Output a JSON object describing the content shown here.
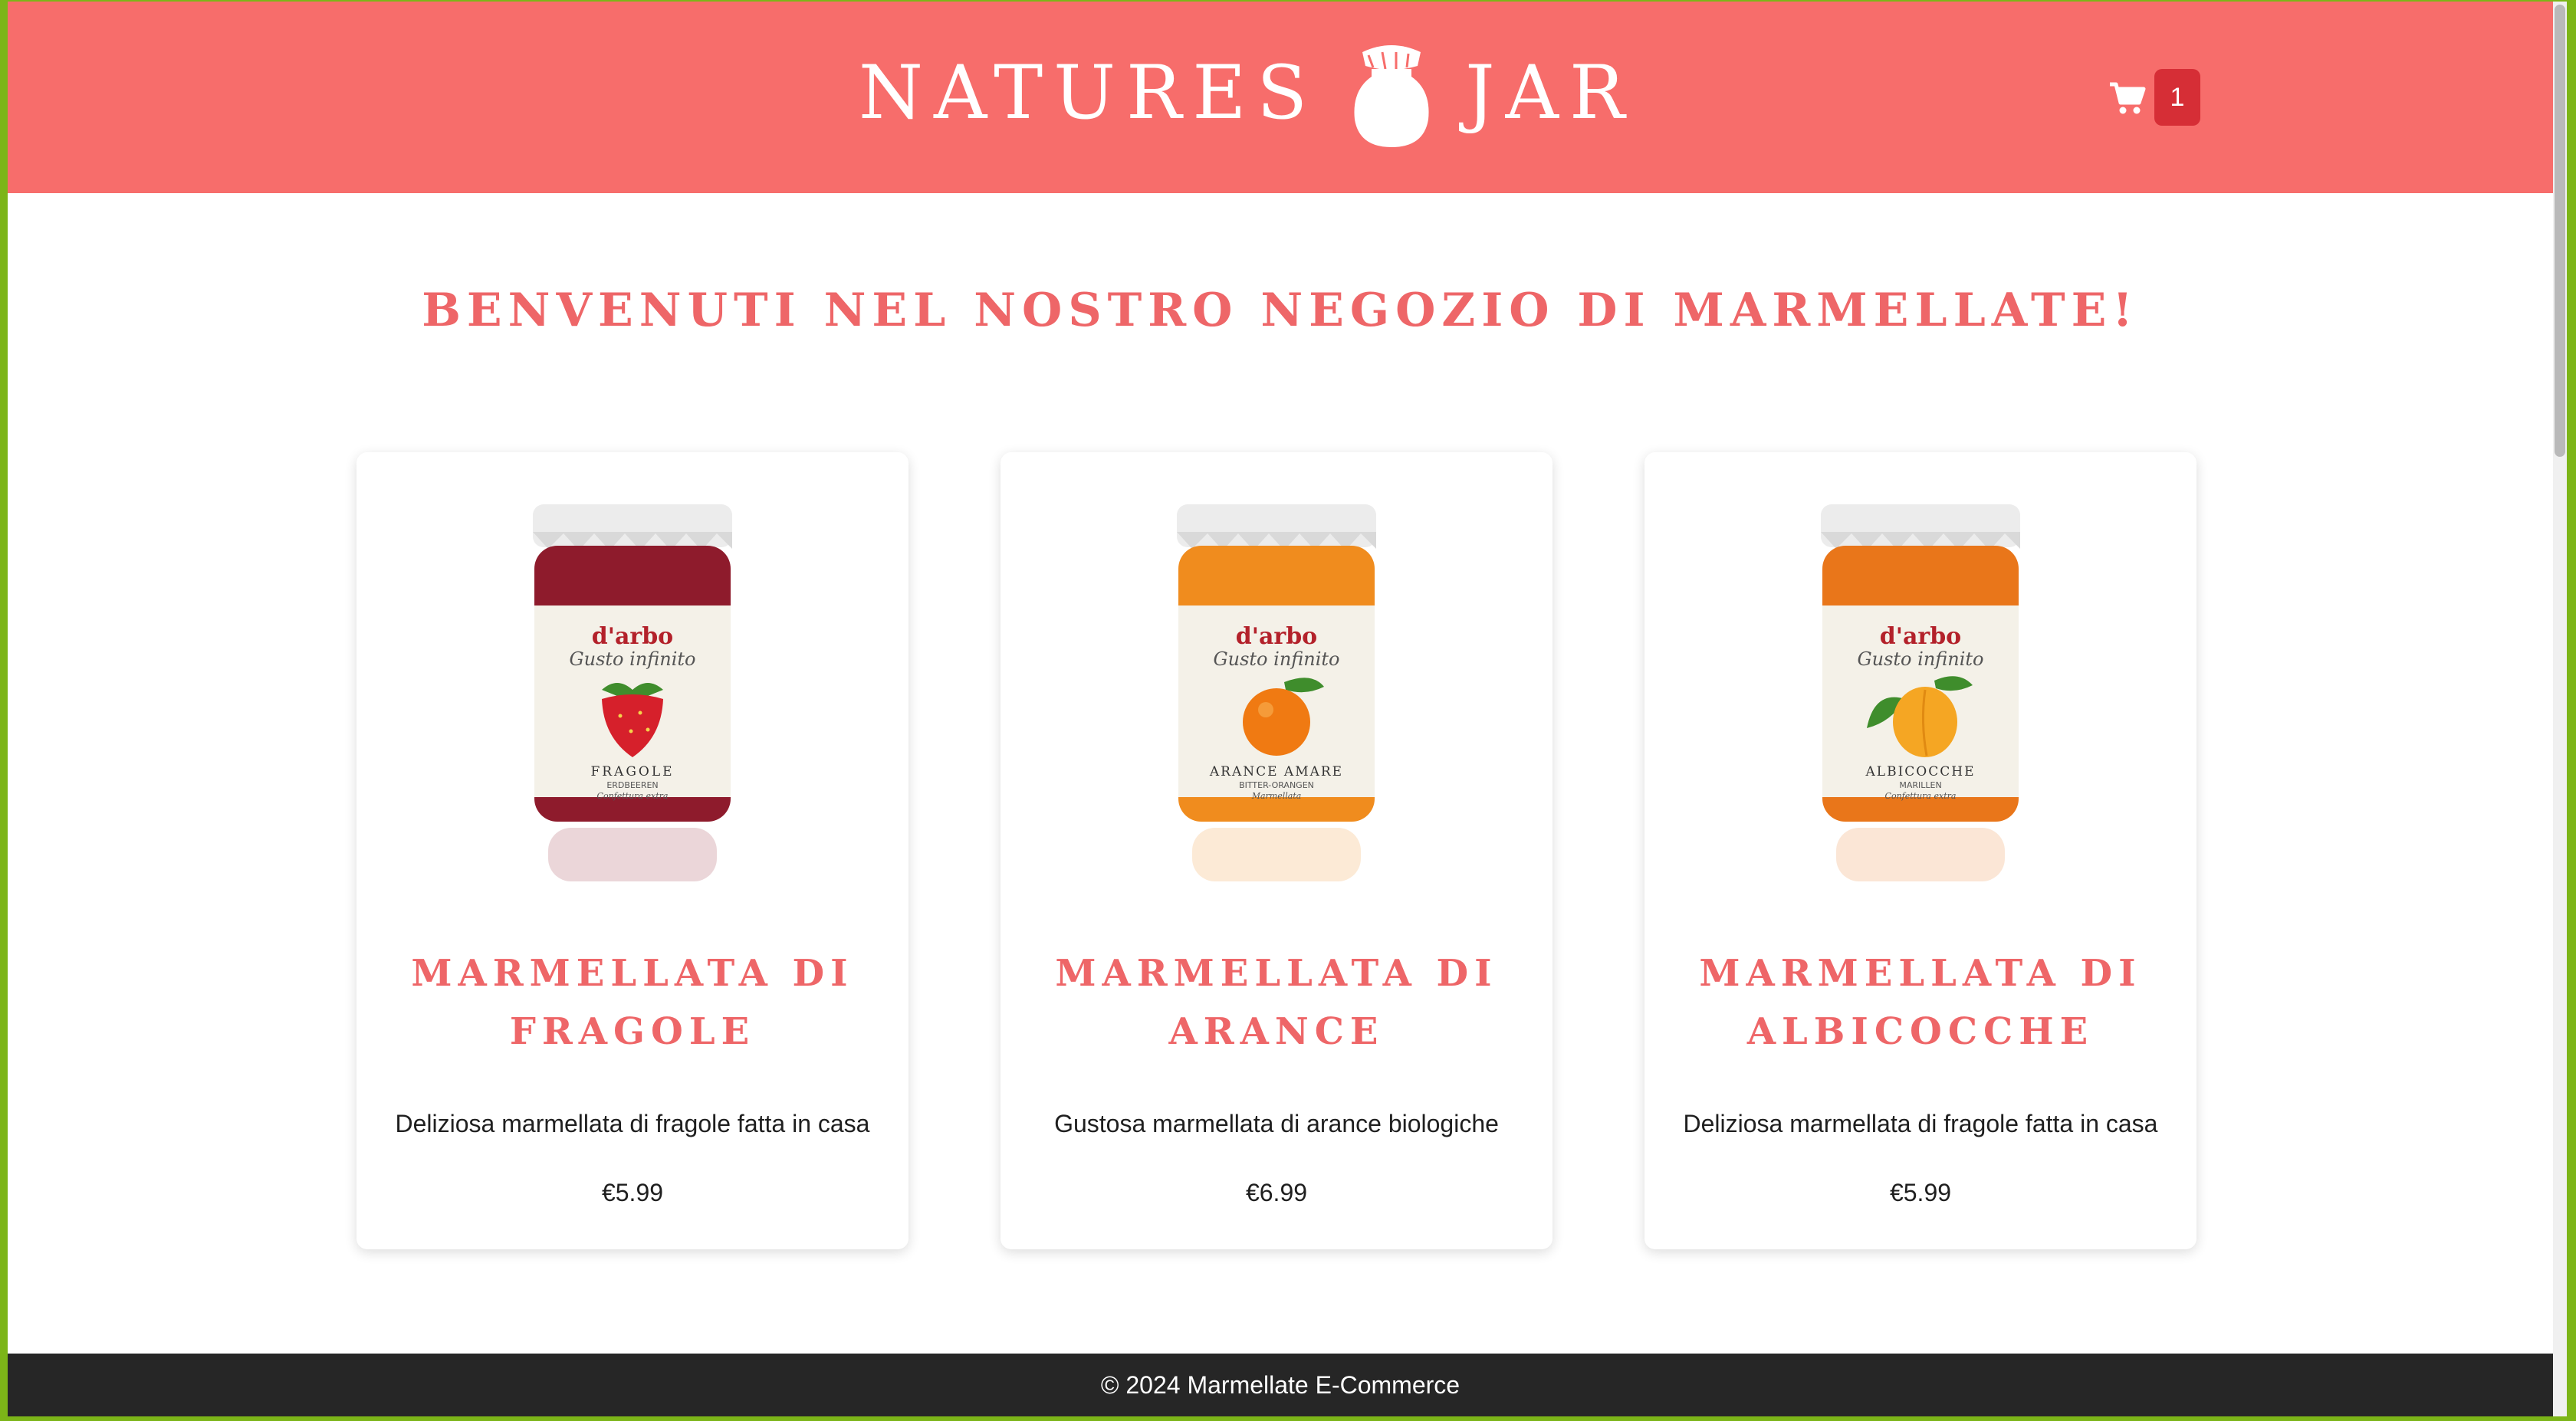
{
  "header": {
    "logo": {
      "word1": "NATURES",
      "word2": "JAR",
      "icon": "jar-icon"
    },
    "cart": {
      "icon": "cart-icon",
      "count": "1"
    }
  },
  "colors": {
    "header_bg": "#f76d6b",
    "accent_text": "#ee6668",
    "badge_bg": "#d62e36",
    "footer_bg": "#262626",
    "outer_frame": "#7cb518"
  },
  "main": {
    "welcome": "BENVENUTI NEL NOSTRO NEGOZIO DI MARMELLATE!",
    "products": [
      {
        "title": "MARMELLATA DI FRAGOLE",
        "description": "Deliziosa marmellata di fragole fatta in casa",
        "price": "€5.99",
        "image": {
          "brand": "d'arbo",
          "line": "Gusto infinito",
          "fruit": "FRAGOLE",
          "fruit_alt": "ERDBEEREN",
          "note": "Confettura extra",
          "fruit_icon": "strawberry-icon",
          "jam_color": "#8e1b2c"
        }
      },
      {
        "title": "MARMELLATA DI ARANCE",
        "description": "Gustosa marmellata di arance biologiche",
        "price": "€6.99",
        "image": {
          "brand": "d'arbo",
          "line": "Gusto infinito",
          "fruit": "ARANCE AMARE",
          "fruit_alt": "BITTER-ORANGEN",
          "note": "Marmellata",
          "fruit_icon": "orange-icon",
          "jam_color": "#f08c1e"
        }
      },
      {
        "title": "MARMELLATA DI ALBICOCCHE",
        "description": "Deliziosa marmellata di fragole fatta in casa",
        "price": "€5.99",
        "image": {
          "brand": "d'arbo",
          "line": "Gusto infinito",
          "fruit": "ALBICOCCHE",
          "fruit_alt": "MARILLEN",
          "note": "Confettura extra",
          "fruit_icon": "apricot-icon",
          "jam_color": "#e9761a"
        }
      }
    ]
  },
  "footer": {
    "text": "© 2024 Marmellate E-Commerce"
  }
}
